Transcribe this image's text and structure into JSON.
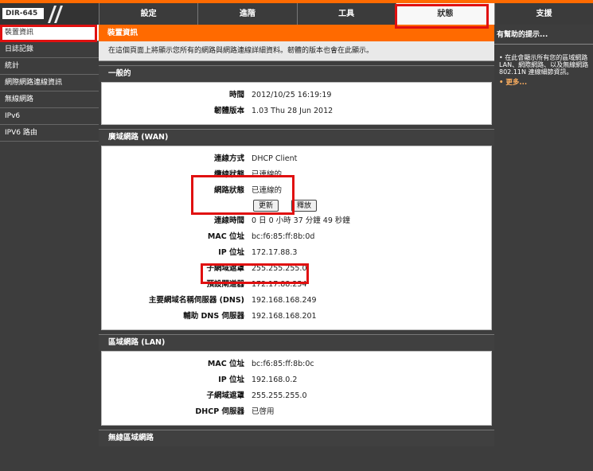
{
  "header": {
    "model": "DIR-645",
    "tabs": [
      "設定",
      "進階",
      "工具",
      "狀態"
    ],
    "help_tab": "支援"
  },
  "sidebar": {
    "items": [
      "裝置資訊",
      "日誌記錄",
      "統計",
      "網際網路連線資訊",
      "無線網路",
      "IPv6",
      "IPV6 路由"
    ]
  },
  "main": {
    "title": "裝置資訊",
    "intro": "在這個頁面上將顯示您所有的網路與網路連線詳細資料。韌體的版本也會在此顯示。",
    "general": {
      "title": "一般的",
      "time_label": "時間",
      "time_value": "2012/10/25 16:19:19",
      "fw_label": "韌體版本",
      "fw_value": "1.03 Thu 28 Jun 2012"
    },
    "wan": {
      "title": "廣域網路 (WAN)",
      "conn_type_label": "連線方式",
      "conn_type_value": "DHCP Client",
      "cable_label": "纜線狀態",
      "cable_value": "已連線的",
      "net_label": "網路狀態",
      "net_value": "已連線的",
      "renew_btn": "更新",
      "release_btn": "釋放",
      "uptime_label": "連線時間",
      "uptime_value": "0 日 0 小時 37 分鐘 49 秒鐘",
      "mac_label": "MAC 位址",
      "mac_value": "bc:f6:85:ff:8b:0d",
      "ip_label": "IP 位址",
      "ip_value": "172.17.88.3",
      "mask_label": "子網域遮罩",
      "mask_value": "255.255.255.0",
      "gw_label": "預設閘道器",
      "gw_value": "172.17.88.254",
      "dns1_label": "主要網域名稱伺服器 (DNS)",
      "dns1_value": "192.168.168.249",
      "dns2_label": "輔助 DNS 伺服器",
      "dns2_value": "192.168.168.201"
    },
    "lan": {
      "title": "區域網路 (LAN)",
      "mac_label": "MAC 位址",
      "mac_value": "bc:f6:85:ff:8b:0c",
      "ip_label": "IP 位址",
      "ip_value": "192.168.0.2",
      "mask_label": "子網域遮罩",
      "mask_value": "255.255.255.0",
      "dhcp_label": "DHCP 伺服器",
      "dhcp_value": "已啓用"
    },
    "wlan": {
      "title": "無線區域網路"
    }
  },
  "help": {
    "title": "有幫助的提示...",
    "text": "• 在此會顯示所有您的區域網路 LAN、網際網路、以及無線網路 802.11N 連線細節資訊。",
    "more": "• 更多..."
  },
  "colors": {
    "accent": "#ff6a00",
    "annotation": "#e01010"
  }
}
